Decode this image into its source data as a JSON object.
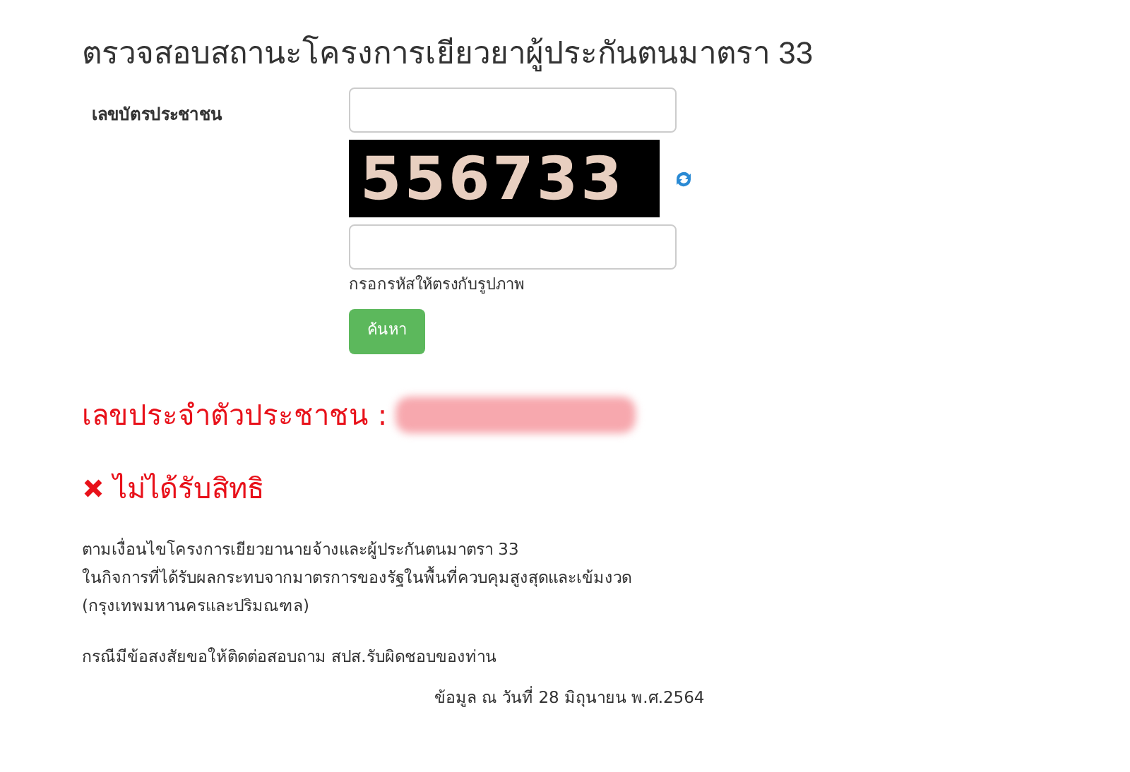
{
  "title": "ตรวจสอบสถานะโครงการเยียวยาผู้ประกันตนมาตรา 33",
  "form": {
    "id_label": "เลขบัตรประชาชน",
    "captcha": "556733",
    "captcha_hint": "กรอกรหัสให้ตรงกับรูปภาพ",
    "submit": "ค้นหา"
  },
  "result": {
    "id_label": "เลขประจำตัวประชาชน :",
    "id_redacted": true,
    "eligible": false,
    "status": "ไม่ได้รับสิทธิ"
  },
  "conditions": [
    "ตามเงื่อนไขโครงการเยียวยานายจ้างและผู้ประกันตนมาตรา 33",
    "ในกิจการที่ได้รับผลกระทบจากมาตรการของรัฐในพื้นที่ควบคุมสูงสุดและเข้มงวด",
    "(กรุงเทพมหานครและปริมณฑล)"
  ],
  "contact": "กรณีมีข้อสงสัยขอให้ติดต่อสอบถาม สปส.รับผิดชอบของท่าน",
  "data_date": "ข้อมูล ณ วันที่ 28 มิถุนายน พ.ศ.2564"
}
